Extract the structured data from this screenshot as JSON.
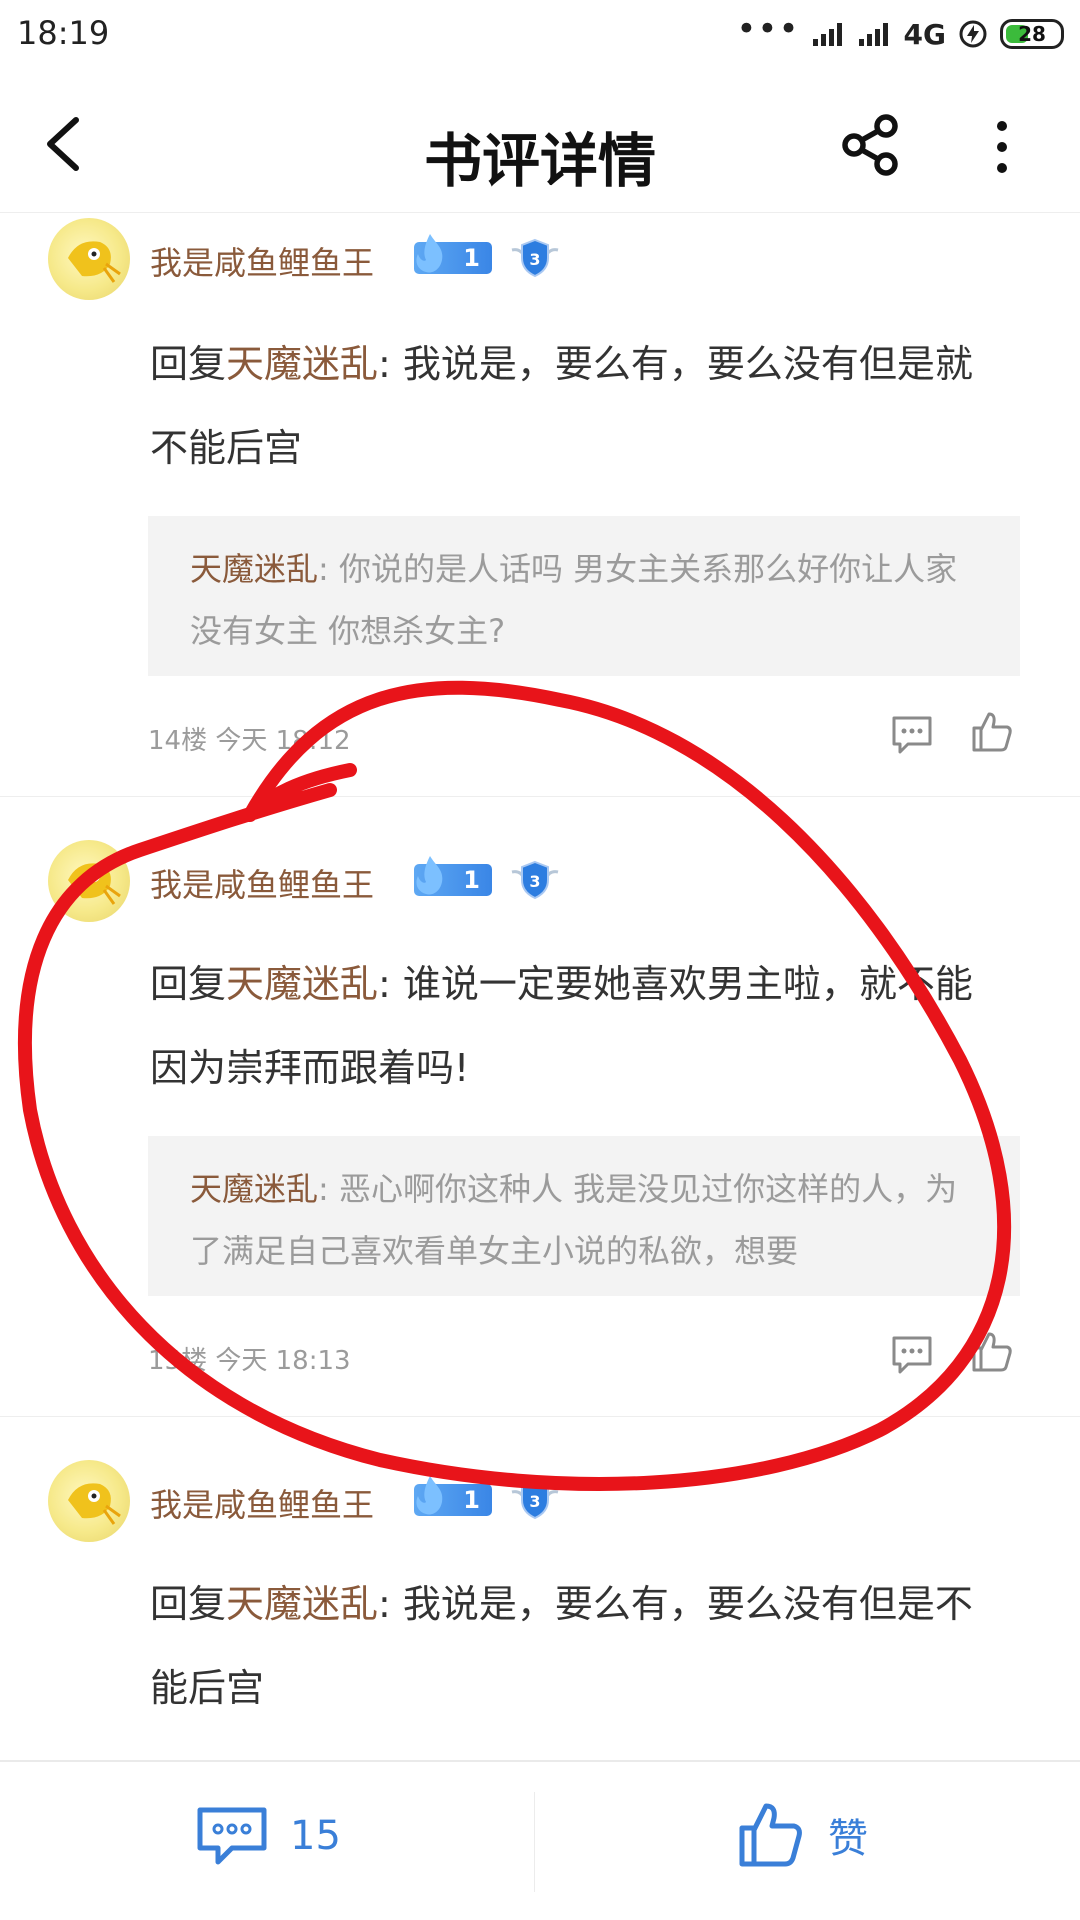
{
  "status_bar": {
    "time": "18:19",
    "network": "4G",
    "battery": "28"
  },
  "nav": {
    "title": "书评详情",
    "back_icon": "chevron-left-icon",
    "share_icon": "share-icon",
    "more_icon": "more-vertical-icon"
  },
  "comments": [
    {
      "user": "我是咸鱼鲤鱼王",
      "fire_level": "1",
      "badge_level": "3",
      "reply_prefix": "回复",
      "reply_to": "天魔迷乱",
      "colon": ": ",
      "body": "我说是，要么有，要么没有但是就不能后宫",
      "quote_name": "天魔迷乱",
      "quote_text": ": 你说的是人话吗 男女主关系那么好你让人家没有女主 你想杀女主?",
      "meta": "14楼 今天 18:12"
    },
    {
      "user": "我是咸鱼鲤鱼王",
      "fire_level": "1",
      "badge_level": "3",
      "reply_prefix": "回复",
      "reply_to": "天魔迷乱",
      "colon": ": ",
      "body": "谁说一定要她喜欢男主啦，就不能因为崇拜而跟着吗!",
      "quote_name": "天魔迷乱",
      "quote_text": ": 恶心啊你这种人 我是没见过你这样的人，为了满足自己喜欢看单女主小说的私欲，想要",
      "meta": "15楼 今天 18:13"
    },
    {
      "user": "我是咸鱼鲤鱼王",
      "fire_level": "1",
      "badge_level": "3",
      "reply_prefix": "回复",
      "reply_to": "天魔迷乱",
      "colon": ": ",
      "body": "我说是，要么有，要么没有但是不能后宫"
    }
  ],
  "bottom_bar": {
    "comment_count": "15",
    "like_label": "赞"
  },
  "colors": {
    "username": "#8a5a3b",
    "accent_blue": "#3a7fd8",
    "annotation_red": "#e8141a"
  }
}
